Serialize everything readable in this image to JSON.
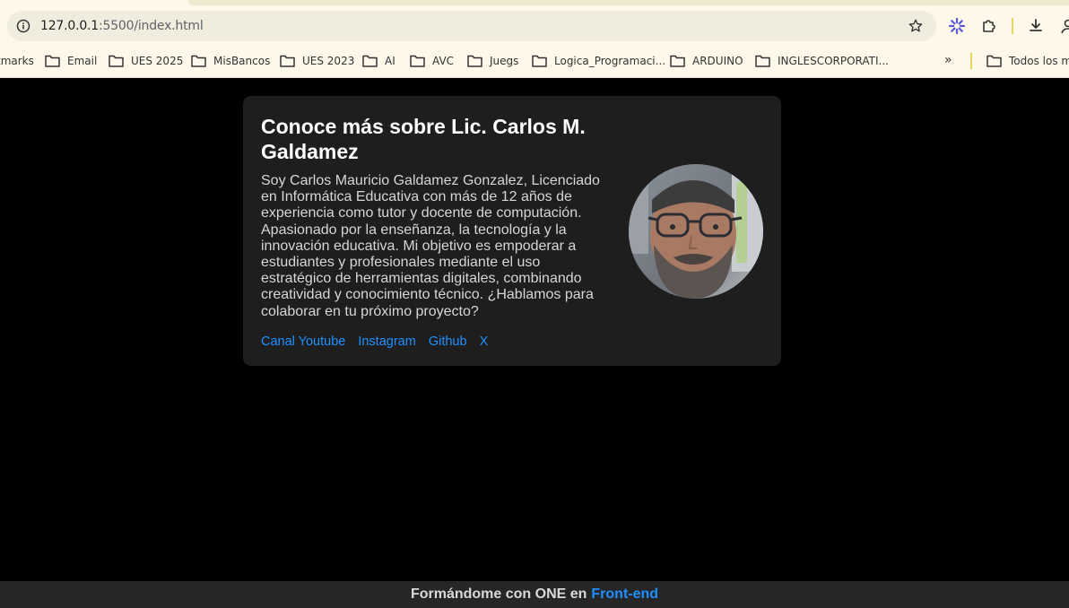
{
  "browser": {
    "url_host": "127.0.0.1",
    "url_path": ":5500/index.html",
    "bookmarks": [
      "tmarks",
      "Email",
      "UES 2025",
      "MisBancos",
      "UES 2023",
      "AI",
      "AVC",
      "Juegs",
      "Logica_Programaci...",
      "ARDUINO",
      "INGLESCORPORATI..."
    ],
    "more_bookmarks": "»",
    "all_bookmarks": "Todos los ma"
  },
  "card": {
    "title": "Conoce más sobre Lic. Carlos M. Galdamez",
    "bio": "Soy Carlos Mauricio Galdamez Gonzalez, Licenciado en Informática Educativa con más de 12 años de experiencia como tutor y docente de computación. Apasionado por la enseñanza, la tecnología y la innovación educativa. Mi objetivo es empoderar a estudiantes y profesionales mediante el uso estratégico de herramientas digitales, combinando creatividad y conocimiento técnico. ¿Hablamos para colaborar en tu próximo proyecto?",
    "links": [
      "Canal Youtube",
      "Instagram",
      "Github",
      "X"
    ]
  },
  "footer": {
    "text": "Formándome con ONE en",
    "accent": "Front-end"
  },
  "colors": {
    "background": "#000000",
    "card": "#1e1e1e",
    "link": "#1e90ff"
  }
}
